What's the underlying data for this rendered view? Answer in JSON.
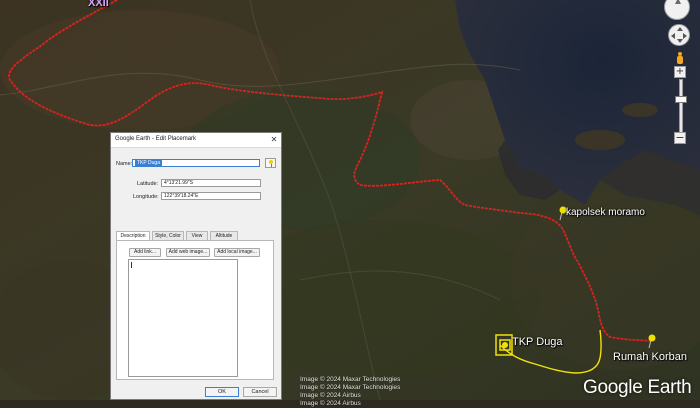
{
  "map": {
    "labels": {
      "kapolsek": "kapolsek moramo",
      "tkp": "TKP Duga",
      "rumah": "Rumah Korban",
      "top": "XXII"
    },
    "credits": [
      "Image © 2024 Maxar Technologies",
      "Image © 2024 Maxar Technologies",
      "Image © 2024 Airbus",
      "Image © 2024 Airbus"
    ],
    "logo": "Google Earth",
    "colors": {
      "route_red": "#d8241f",
      "route_yellow": "#f2e20a",
      "pin_yellow": "#f0e000"
    }
  },
  "nav": {
    "zoom_in": "+",
    "zoom_out": "−"
  },
  "dialog": {
    "title": "Google Earth - Edit Placemark",
    "close": "✕",
    "name_label": "Name:",
    "name_value": "TKP Duga",
    "lat_label": "Latitude:",
    "lat_value": "4°13'21.99\"S",
    "lon_label": "Longitude:",
    "lon_value": "122°39'18.24\"E",
    "tabs": [
      "Description",
      "Style, Color",
      "View",
      "Altitude"
    ],
    "buttons": [
      "Add link...",
      "Add web image...",
      "Add local image..."
    ],
    "ok": "OK",
    "cancel": "Cancel"
  }
}
